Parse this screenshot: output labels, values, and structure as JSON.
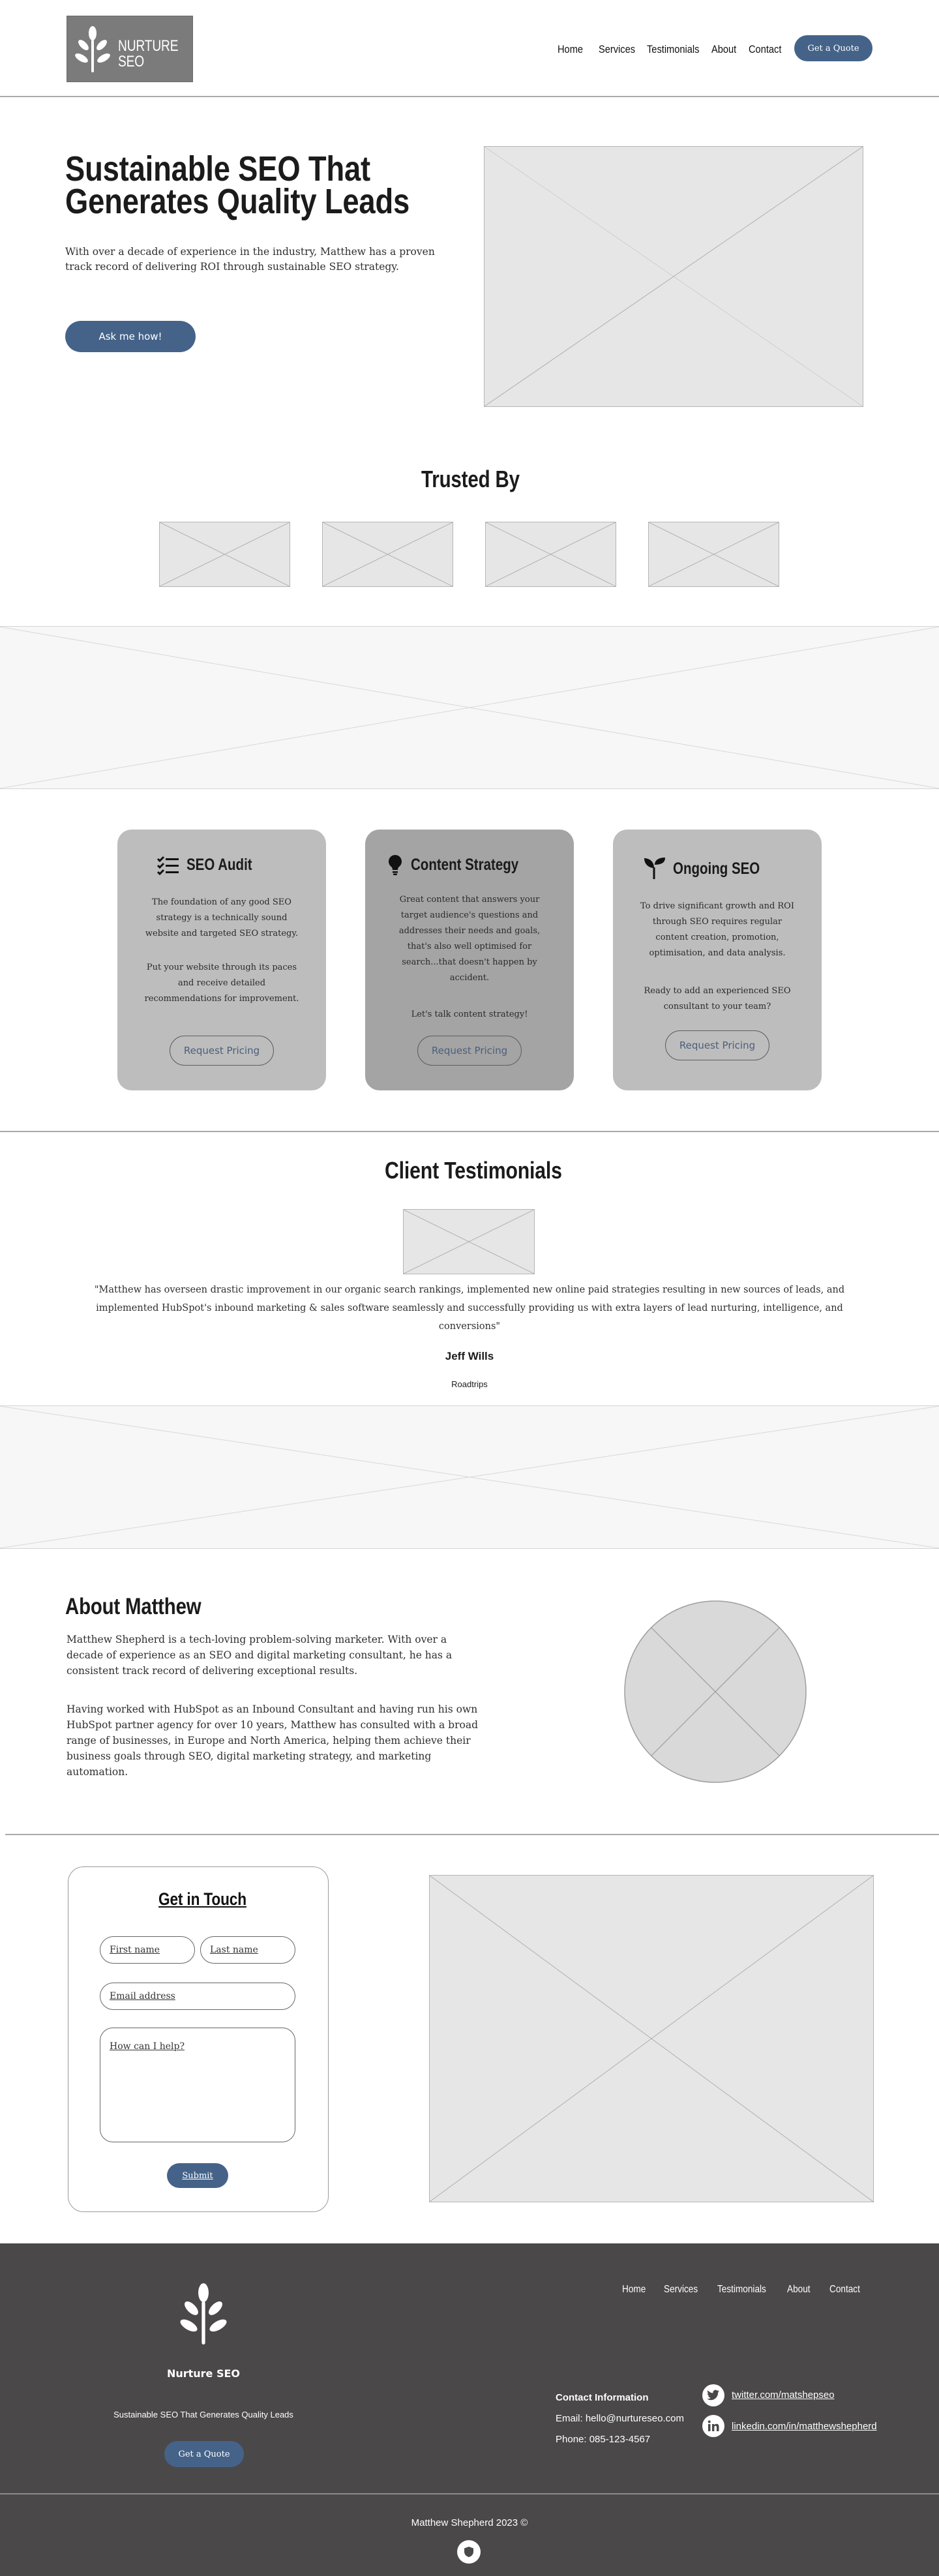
{
  "header": {
    "logo_line1": "NURTURE",
    "logo_line2": "SEO",
    "nav": [
      "Home",
      "Services",
      "Testimonials",
      "About",
      "Contact"
    ],
    "cta": "Get a Quote"
  },
  "hero": {
    "title_line1": "Sustainable SEO That",
    "title_line2": "Generates Quality Leads",
    "text_line1": "With over a decade of experience in the industry, Matthew has a proven",
    "text_line2": "track record of delivering ROI through sustainable SEO strategy.",
    "button": "Ask me how!"
  },
  "trusted": {
    "title": "Trusted By"
  },
  "services": [
    {
      "title": "SEO Audit",
      "icon": "checklist-icon",
      "paragraph1": "The foundation of any good SEO strategy is a technically sound website and targeted SEO strategy.",
      "paragraph2": "Put your website through its paces and receive detailed recommendations for improvement.",
      "button": "Request Pricing"
    },
    {
      "title": "Content Strategy",
      "icon": "lightbulb-icon",
      "paragraph1": "Great content that answers your target audience's questions and addresses their needs and goals, that's also well optimised for search...that doesn't happen by accident.",
      "paragraph2": "Let's talk content strategy!",
      "button": "Request Pricing"
    },
    {
      "title": "Ongoing SEO",
      "icon": "seedling-icon",
      "paragraph1": "To drive significant growth and ROI through SEO requires regular content creation, promotion, optimisation, and data analysis.",
      "paragraph2": "Ready to add an experienced SEO consultant to your team?",
      "button": "Request Pricing"
    }
  ],
  "testimonials": {
    "title": "Client Testimonials",
    "quote_line1": "\"Matthew has  overseen drastic improvement in our organic search rankings, implemented new online paid strategies resulting in new sources of leads, and",
    "quote_line2": "implemented HubSpot's inbound marketing & sales software seamlessly and successfully providing us with extra layers of lead nurturing, intelligence, and",
    "quote_line3": "conversions\"",
    "author": "Jeff Wills",
    "company": "Roadtrips"
  },
  "about": {
    "title": "About Matthew",
    "p1_line1": "Matthew Shepherd is a tech-loving problem-solving marketer. With over a",
    "p1_line2": "decade of experience as an SEO and digital marketing consultant, he has a",
    "p1_line3": "consistent track record of delivering exceptional results.",
    "p2_line1": "Having worked with HubSpot as an Inbound Consultant and having run his own",
    "p2_line2": "HubSpot partner agency for over 10 years, Matthew has consulted with a broad",
    "p2_line3": "range of businesses, in Europe and North America, helping them achieve their",
    "p2_line4": "business goals through SEO, digital marketing strategy, and marketing",
    "p2_line5": "automation."
  },
  "contact_form": {
    "title": "Get in Touch",
    "first_name": "First name",
    "last_name": "Last name",
    "email": "Email address",
    "message": "How can I help?",
    "submit": "Submit"
  },
  "footer": {
    "logo_text": "Nurture SEO",
    "tagline": "Sustainable SEO That Generates Quality Leads",
    "cta": "Get a Quote",
    "nav": [
      "Home",
      "Services",
      "Testimonials",
      "About",
      "Contact"
    ],
    "contact_title": "Contact Information",
    "email": "Email: hello@nurtureseo.com",
    "phone": "Phone: 085-123-4567",
    "twitter": "twitter.com/matshepseo",
    "linkedin": "linkedin.com/in/matthewshepherd",
    "copyright": "Matthew Shepherd 2023  ©"
  },
  "colors": {
    "accent": "#456389",
    "footer_bg": "#4a4849",
    "card_bg": "#bdbdbd",
    "card_bg_dark": "#a4a4a4",
    "placeholder": "#e6e6e6"
  }
}
